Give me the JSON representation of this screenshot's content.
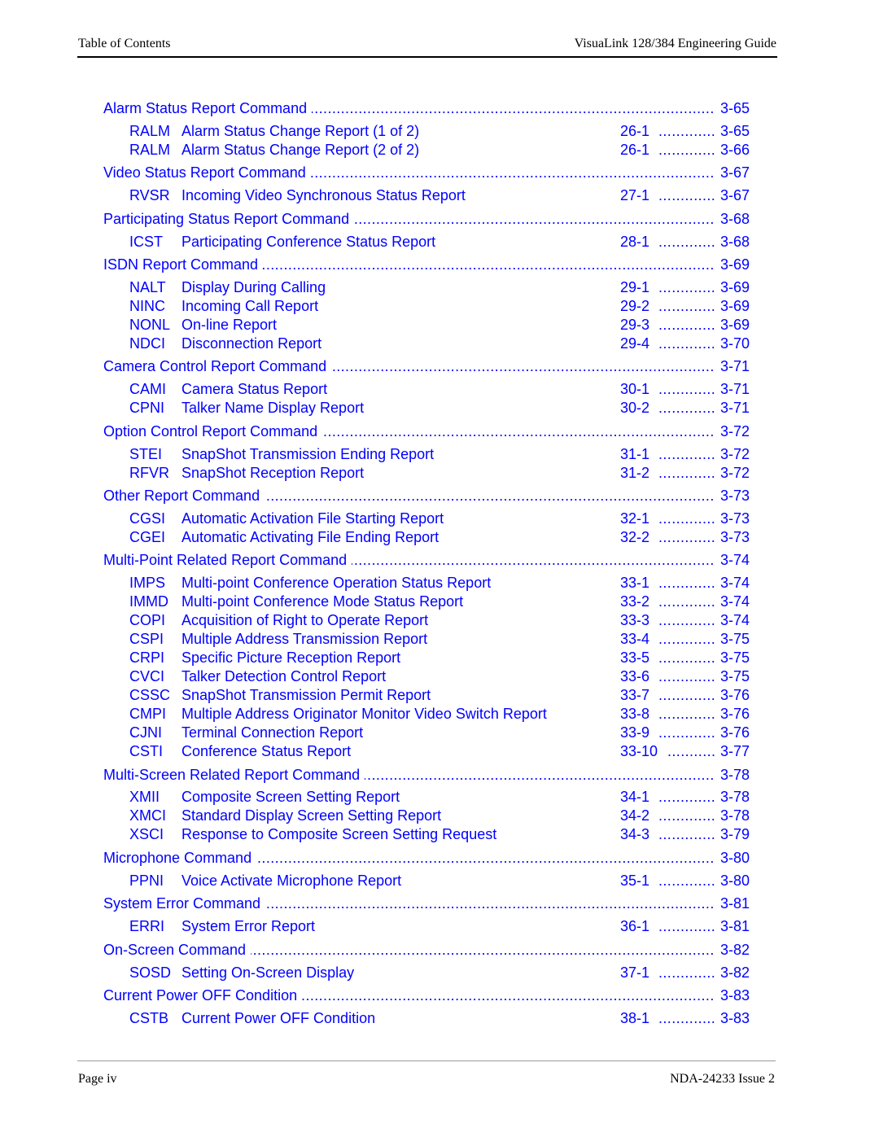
{
  "header": {
    "left": "Table of Contents",
    "right": "VisuaLink 128/384 Engineering Guide"
  },
  "footer": {
    "left": "Page iv",
    "right": "NDA-24233 Issue 2"
  },
  "colors": {
    "link": "#0000FF",
    "text": "#000000"
  },
  "leader_char": ".",
  "entries": [
    {
      "type": "section",
      "title": "Alarm Status Report Command",
      "page": "3-65"
    },
    {
      "type": "item",
      "code": "RALM",
      "desc": "Alarm Status Change Report (1 of 2)",
      "fig": "26-1",
      "page": "3-65"
    },
    {
      "type": "item",
      "code": "RALM",
      "desc": "Alarm Status Change Report (2 of 2)",
      "fig": "26-1",
      "page": "3-66"
    },
    {
      "type": "section",
      "title": "Video Status Report Command",
      "page": "3-67"
    },
    {
      "type": "item",
      "code": "RVSR",
      "desc": "Incoming Video Synchronous Status Report",
      "fig": "27-1",
      "page": "3-67"
    },
    {
      "type": "section",
      "title": "Participating Status Report Command",
      "page": "3-68"
    },
    {
      "type": "item",
      "code": "ICST",
      "desc": "Participating Conference Status Report",
      "fig": "28-1",
      "page": "3-68"
    },
    {
      "type": "section",
      "title": "ISDN Report Command",
      "page": "3-69"
    },
    {
      "type": "item",
      "code": "NALT",
      "desc": "Display During Calling",
      "fig": "29-1",
      "page": "3-69"
    },
    {
      "type": "item",
      "code": "NINC",
      "desc": "Incoming Call Report",
      "fig": "29-2",
      "page": "3-69"
    },
    {
      "type": "item",
      "code": "NONL",
      "desc": "On-line Report",
      "fig": "29-3",
      "page": "3-69"
    },
    {
      "type": "item",
      "code": "NDCI",
      "desc": "Disconnection Report",
      "fig": "29-4",
      "page": "3-70"
    },
    {
      "type": "section",
      "title": "Camera Control Report Command",
      "page": "3-71"
    },
    {
      "type": "item",
      "code": "CAMI",
      "desc": "Camera Status Report",
      "fig": "30-1",
      "page": "3-71"
    },
    {
      "type": "item",
      "code": "CPNI",
      "desc": "Talker Name Display Report",
      "fig": "30-2",
      "page": "3-71"
    },
    {
      "type": "section",
      "title": "Option Control Report Command",
      "page": "3-72"
    },
    {
      "type": "item",
      "code": "STEI",
      "desc": "SnapShot Transmission Ending Report",
      "fig": "31-1",
      "page": "3-72"
    },
    {
      "type": "item",
      "code": "RFVR",
      "desc": "SnapShot Reception Report",
      "fig": "31-2",
      "page": "3-72"
    },
    {
      "type": "section",
      "title": "Other Report Command",
      "page": "3-73"
    },
    {
      "type": "item",
      "code": "CGSI",
      "desc": "Automatic Activation File Starting Report",
      "fig": "32-1",
      "page": "3-73"
    },
    {
      "type": "item",
      "code": "CGEI",
      "desc": "Automatic Activating File Ending Report",
      "fig": "32-2",
      "page": "3-73"
    },
    {
      "type": "section",
      "title": "Multi-Point  Related Report Command",
      "page": "3-74"
    },
    {
      "type": "item",
      "code": "IMPS",
      "desc": "Multi-point Conference Operation Status Report",
      "fig": "33-1",
      "page": "3-74"
    },
    {
      "type": "item",
      "code": "IMMD",
      "desc": "Multi-point Conference Mode Status Report",
      "fig": "33-2",
      "page": "3-74"
    },
    {
      "type": "item",
      "code": "COPI",
      "desc": "Acquisition of Right to Operate Report",
      "fig": "33-3",
      "page": "3-74"
    },
    {
      "type": "item",
      "code": "CSPI",
      "desc": "Multiple Address Transmission Report",
      "fig": "33-4",
      "page": "3-75"
    },
    {
      "type": "item",
      "code": "CRPI",
      "desc": "Specific Picture Reception Report",
      "fig": "33-5",
      "page": "3-75"
    },
    {
      "type": "item",
      "code": "CVCI",
      "desc": "Talker Detection Control Report",
      "fig": "33-6",
      "page": "3-75"
    },
    {
      "type": "item",
      "code": "CSSC",
      "desc": "SnapShot Transmission Permit Report",
      "fig": "33-7",
      "page": "3-76"
    },
    {
      "type": "item",
      "code": "CMPI",
      "desc": "Multiple Address Originator Monitor Video Switch Report",
      "fig": "33-8",
      "page": "3-76"
    },
    {
      "type": "item",
      "code": "CJNI",
      "desc": "Terminal Connection Report",
      "fig": "33-9",
      "page": "3-76"
    },
    {
      "type": "item",
      "code": "CSTI",
      "desc": "Conference Status Report",
      "fig": "33-10",
      "page": "3-77"
    },
    {
      "type": "section",
      "title": "Multi-Screen Related Report Command",
      "page": "3-78"
    },
    {
      "type": "item",
      "code": "XMII",
      "desc": "Composite Screen Setting Report",
      "fig": "34-1",
      "page": "3-78"
    },
    {
      "type": "item",
      "code": "XMCI",
      "desc": "Standard Display Screen Setting Report",
      "fig": "34-2",
      "page": "3-78"
    },
    {
      "type": "item",
      "code": "XSCI",
      "desc": "Response to Composite Screen Setting Request",
      "fig": "34-3",
      "page": "3-79"
    },
    {
      "type": "section",
      "title": "Microphone Command",
      "page": "3-80"
    },
    {
      "type": "item",
      "code": "PPNI",
      "desc": "Voice Activate Microphone Report",
      "fig": "35-1",
      "page": "3-80"
    },
    {
      "type": "section",
      "title": "System Error Command",
      "page": "3-81"
    },
    {
      "type": "item",
      "code": "ERRI",
      "desc": "System Error Report",
      "fig": "36-1",
      "page": "3-81"
    },
    {
      "type": "section",
      "title": "On-Screen Command",
      "page": "3-82"
    },
    {
      "type": "item",
      "code": "SOSD",
      "desc": "Setting On-Screen Display",
      "fig": "37-1",
      "page": "3-82"
    },
    {
      "type": "section",
      "title": "Current Power OFF Condition",
      "page": "3-83"
    },
    {
      "type": "item",
      "code": "CSTB",
      "desc": "Current Power OFF Condition",
      "fig": "38-1",
      "page": "3-83"
    }
  ]
}
